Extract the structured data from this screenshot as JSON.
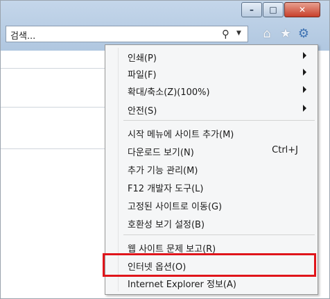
{
  "search": {
    "placeholder": "검색..."
  },
  "window_controls": {
    "minimize": "–",
    "maximize": "□",
    "close": "✕"
  },
  "toolbar": {
    "home_icon": "home-icon",
    "favorites_icon": "star-icon",
    "tools_icon": "gear-icon"
  },
  "menu": {
    "items": [
      {
        "label": "인쇄(P)",
        "shortcut": "",
        "submenu": true
      },
      {
        "label": "파일(F)",
        "shortcut": "",
        "submenu": true
      },
      {
        "label": "확대/축소(Z)(100%)",
        "shortcut": "",
        "submenu": true
      },
      {
        "label": "안전(S)",
        "shortcut": "",
        "submenu": true
      },
      {
        "label": "시작 메뉴에 사이트 추가(M)",
        "shortcut": "",
        "submenu": false
      },
      {
        "label": "다운로드 보기(N)",
        "shortcut": "Ctrl+J",
        "submenu": false
      },
      {
        "label": "추가 기능 관리(M)",
        "shortcut": "",
        "submenu": false
      },
      {
        "label": "F12 개발자 도구(L)",
        "shortcut": "",
        "submenu": false
      },
      {
        "label": "고정된 사이트로 이동(G)",
        "shortcut": "",
        "submenu": false
      },
      {
        "label": "호환성 보기 설정(B)",
        "shortcut": "",
        "submenu": false
      },
      {
        "label": "웹 사이트 문제 보고(R)",
        "shortcut": "",
        "submenu": false
      },
      {
        "label": "인터넷 옵션(O)",
        "shortcut": "",
        "submenu": false
      },
      {
        "label": "Internet Explorer 정보(A)",
        "shortcut": "",
        "submenu": false
      }
    ]
  },
  "highlight_color": "#e0151b"
}
